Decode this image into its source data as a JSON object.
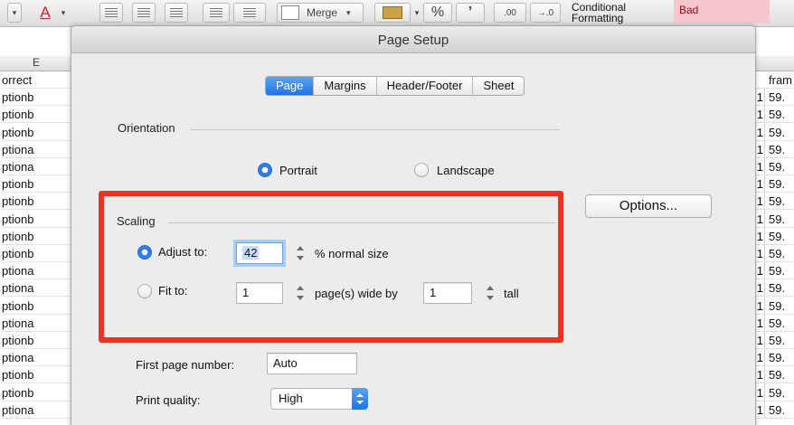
{
  "ribbon": {
    "font_color_letter": "A",
    "merge_label": "Merge",
    "percent_label": "%",
    "comma_label": "’",
    "increase_decimal_label": ".00",
    "decrease_decimal_label": "→.0",
    "conditional_formatting_line1": "Conditional",
    "conditional_formatting_line2": "Formatting",
    "style_bad_label": "Bad"
  },
  "sheet": {
    "left_column_header": "E",
    "left_cells": [
      "orrect",
      "ptionb",
      "ptionb",
      "ptionb",
      "ptiona",
      "ptiona",
      "ptionb",
      "ptionb",
      "ptionb",
      "ptionb",
      "ptionb",
      "ptiona",
      "ptiona",
      "ptionb",
      "ptiona",
      "ptionb",
      "ptiona",
      "ptionb",
      "ptionb",
      "ptiona"
    ],
    "right_header_text": "fram",
    "right_prefix": "1",
    "right_value": "59."
  },
  "dialog": {
    "title": "Page Setup",
    "tabs": [
      "Page",
      "Margins",
      "Header/Footer",
      "Sheet"
    ],
    "active_tab": "Page",
    "orientation": {
      "title": "Orientation",
      "portrait_label": "Portrait",
      "landscape_label": "Landscape",
      "selected": "Portrait"
    },
    "options_button": "Options...",
    "scaling": {
      "title": "Scaling",
      "adjust_to_label": "Adjust to:",
      "adjust_value": "42",
      "normal_size_label": "% normal size",
      "fit_to_label": "Fit to:",
      "fit_wide_value": "1",
      "pages_wide_label": "page(s) wide by",
      "fit_tall_value": "1",
      "tall_label": "tall",
      "selected": "Adjust to:"
    },
    "first_page_number": {
      "label": "First page number:",
      "value": "Auto"
    },
    "print_quality": {
      "label": "Print quality:",
      "value": "High"
    }
  },
  "colors": {
    "accent_blue": "#1f73e6",
    "highlight_red": "#f03222",
    "bad_fill": "#f7c7ce",
    "bad_text": "#9c0a1c"
  }
}
